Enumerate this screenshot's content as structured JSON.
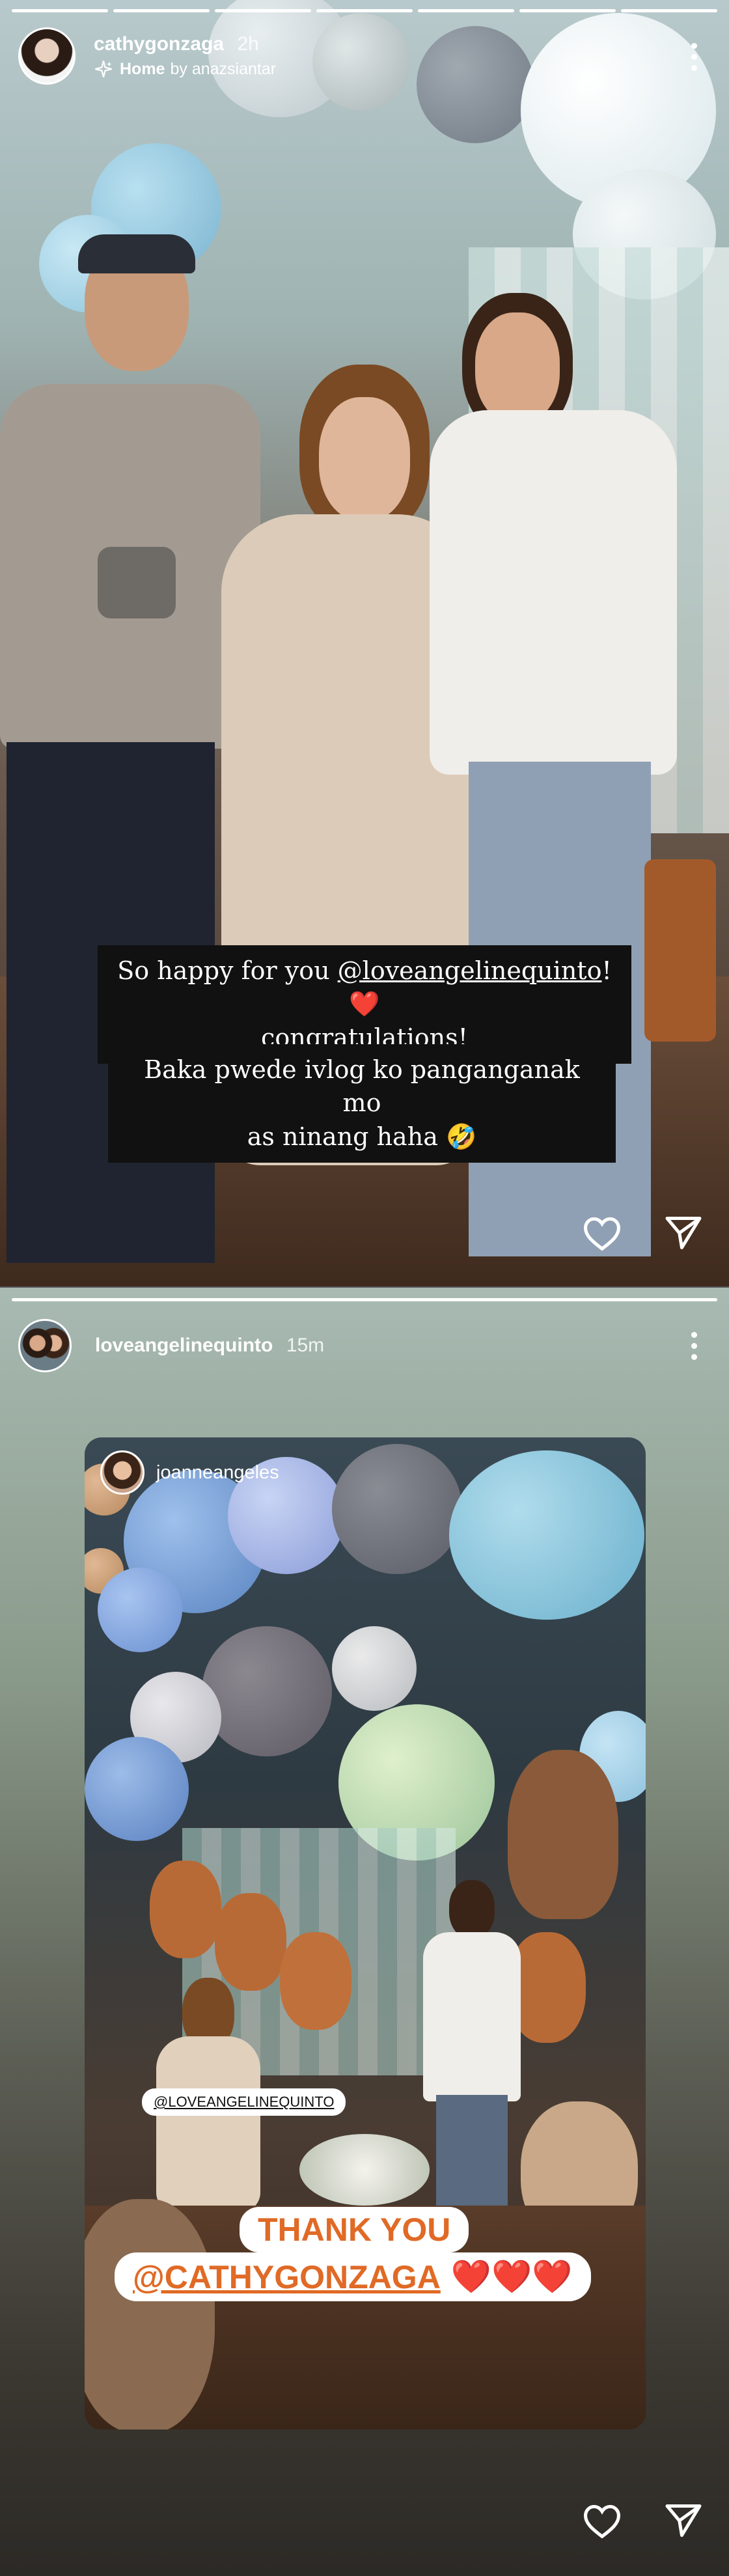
{
  "story1": {
    "progress": {
      "segments": 7,
      "active": 7
    },
    "username": "cathygonzaga",
    "time": "2h",
    "home_label": "Home",
    "by_label": "by anazsiantar",
    "caption1_prefix": "So happy for you ",
    "caption1_mention": "@loveangelinequinto",
    "caption1_suffix": "! ",
    "caption1_line2": "congratulations!",
    "caption2_line1": "Baka pwede ivlog ko panganganak mo",
    "caption2_line2": "as ninang haha",
    "heart_emoji": "❤️",
    "laugh_emoji": "🤣"
  },
  "story2": {
    "progress": {
      "segments": 1,
      "active": 1
    },
    "username": "loveangelinequinto",
    "time": "15m",
    "inner_username": "joanneangeles",
    "mention_chip": "@LOVEANGELINEQUINTO",
    "thank_you_line1": "THANK YOU",
    "thank_you_mention": "@CATHYGONZAGA",
    "hearts": "❤️❤️❤️"
  },
  "colors": {
    "accent_orange": "#e06a26",
    "heart_red": "#e0322e"
  },
  "icons": {
    "more": "more-options-icon",
    "like": "heart-icon",
    "share": "send-icon",
    "sparkle": "sparkle-icon"
  }
}
